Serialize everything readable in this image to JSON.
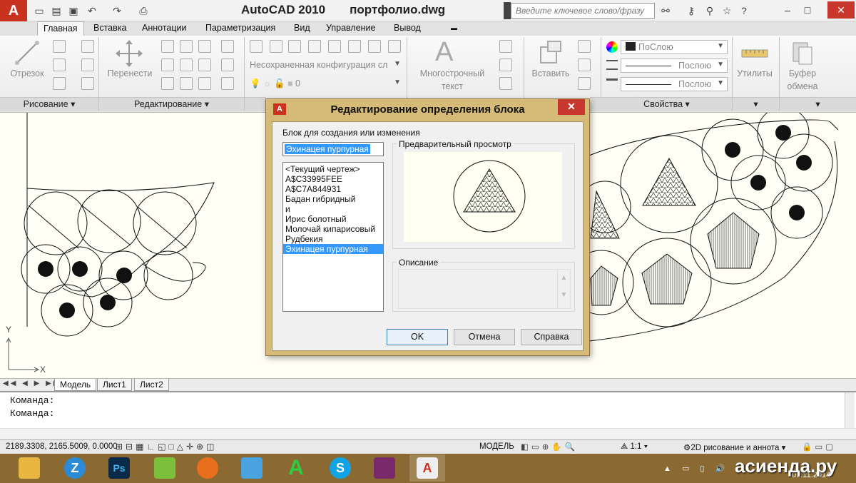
{
  "app": {
    "logo": "A",
    "title": "AutoCAD 2010",
    "file": "портфолио.dwg",
    "search_placeholder": "Введите ключевое слово/фразу"
  },
  "tabs": [
    "Главная",
    "Вставка",
    "Аннотации",
    "Параметризация",
    "Вид",
    "Управление",
    "Вывод"
  ],
  "ribbon": {
    "line_label": "Отрезок",
    "move_label": "Перенести",
    "layer_combo": "Несохраненная конфигурация сл",
    "layer_value": "0",
    "mtext_label1": "Многострочный",
    "mtext_label2": "текст",
    "insert_label": "Вставить",
    "prop_color": "ПоСлою",
    "prop_linetype": "Послою",
    "prop_lineweight": "Послою",
    "utilities_label": "Утилиты",
    "clipboard_label1": "Буфер",
    "clipboard_label2": "обмена",
    "panels": {
      "draw": "Рисование",
      "modify": "Редактирование",
      "properties": "Свойства"
    }
  },
  "dialog": {
    "title": "Редактирование определения блока",
    "block_label": "Блок для создания или изменения",
    "block_name": "Эхинацея пурпурная",
    "blocks": [
      "<Текущий чертеж>",
      "A$C33995FEE",
      "A$C7A844931",
      "Бадан гибридный",
      "и",
      "Ирис болотный",
      "Молочай кипарисовый",
      "Рудбекия",
      "Эхинацея пурпурная"
    ],
    "selected_index": 8,
    "preview_label": "Предварительный просмотр",
    "description_label": "Описание",
    "ok": "OK",
    "cancel": "Отмена",
    "help": "Справка"
  },
  "axes": {
    "x": "X",
    "y": "Y"
  },
  "layouts": [
    "Модель",
    "Лист1",
    "Лист2"
  ],
  "command_lines": [
    "Команда:",
    "Команда:"
  ],
  "status": {
    "coords": "2189.3308, 2165.5009, 0.0000",
    "model": "МОДЕЛЬ",
    "scale": "1:1",
    "workspace": "2D рисование и аннота"
  },
  "taskbar": {
    "time": "01.11.2014",
    "watermark": "асиенда.ру"
  },
  "colors": {
    "dialog_frame": "#d6ba77",
    "selection": "#3399ff",
    "taskbar": "#8a6a32",
    "app_red": "#c8321e"
  }
}
